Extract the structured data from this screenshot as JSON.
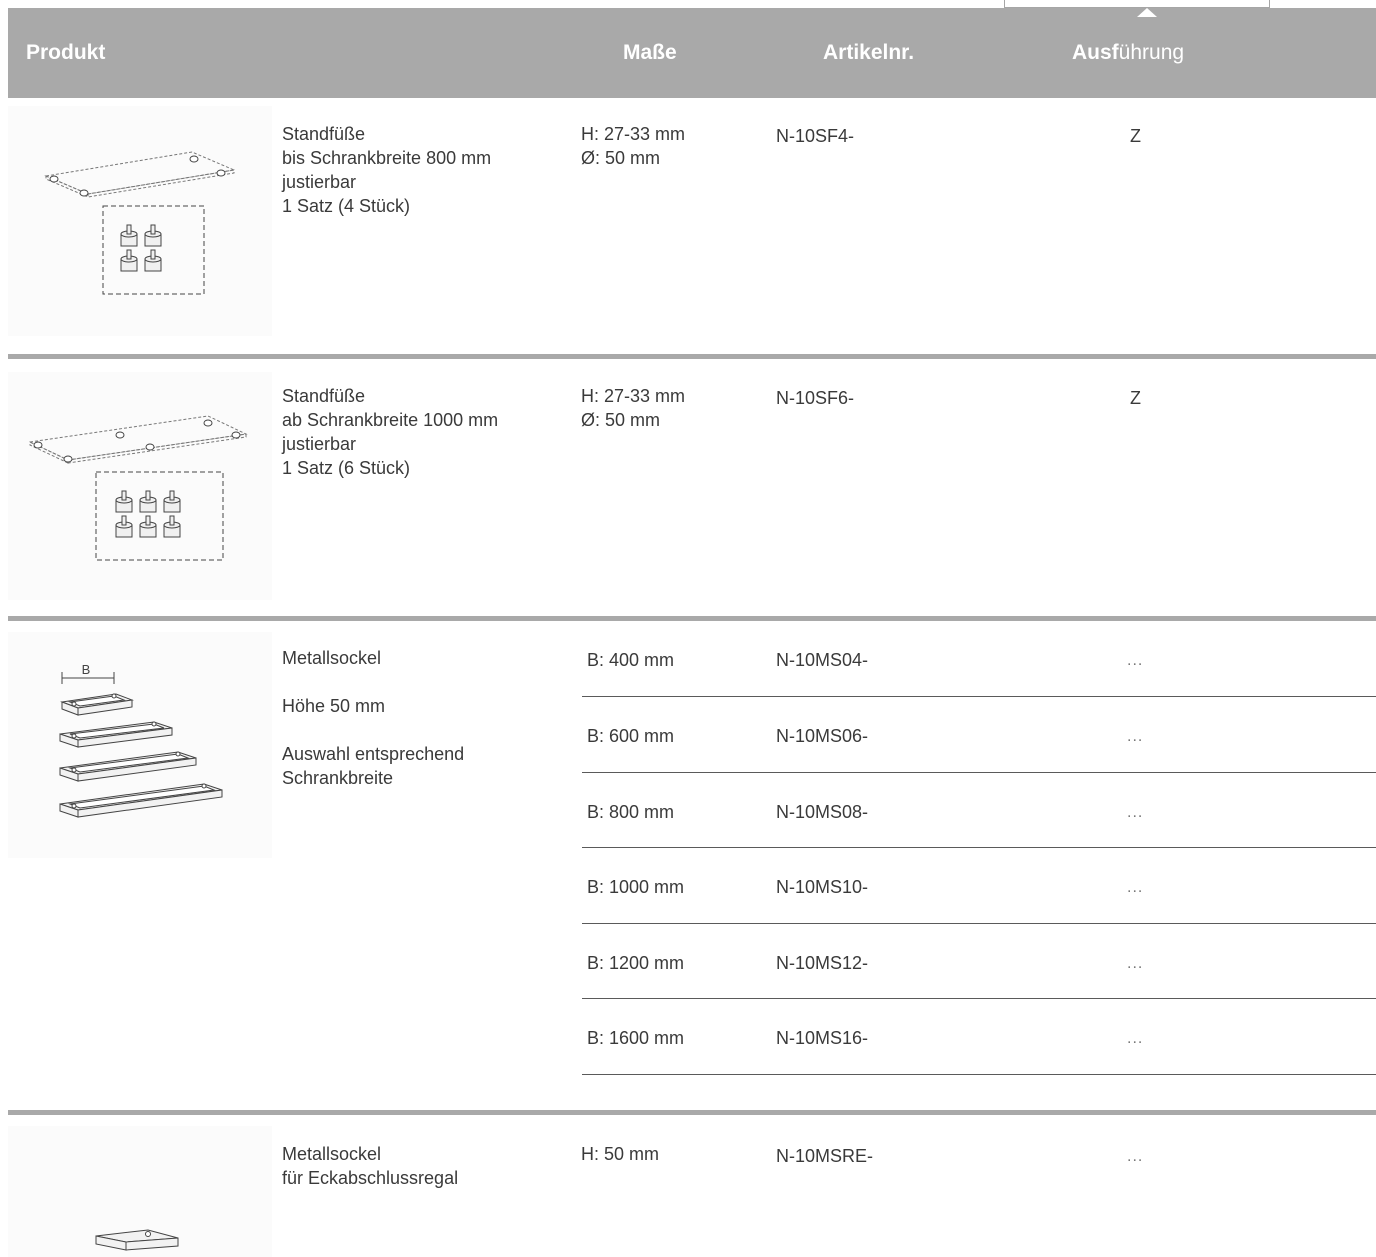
{
  "header": {
    "produkt": "Produkt",
    "masse": "Maße",
    "artikelnr": "Artikelnr.",
    "ausfuehrung_bold": "Ausf",
    "ausfuehrung_rest": "ührung"
  },
  "items": [
    {
      "lines": [
        "Standfüße",
        "bis Schrankbreite 800 mm",
        "justierbar",
        "1 Satz (4 Stück)"
      ],
      "masse": [
        "H: 27-33 mm",
        "Ø: 50 mm"
      ],
      "artikel": "N-10SF4-",
      "ausf": "Z"
    },
    {
      "lines": [
        "Standfüße",
        "ab Schrankbreite 1000 mm",
        "justierbar",
        "1 Satz (6 Stück)"
      ],
      "masse": [
        "H: 27-33 mm",
        "Ø: 50 mm"
      ],
      "artikel": "N-10SF6-",
      "ausf": "Z"
    },
    {
      "lines": [
        "Metallsockel",
        "Höhe 50 mm",
        "Auswahl entsprechend",
        "Schrankbreite"
      ],
      "sublabel": "B",
      "variants": [
        {
          "masse": "B: 400 mm",
          "artikel": "N-10MS04-",
          "ausf": "..."
        },
        {
          "masse": "B: 600 mm",
          "artikel": "N-10MS06-",
          "ausf": "..."
        },
        {
          "masse": "B: 800 mm",
          "artikel": "N-10MS08-",
          "ausf": "..."
        },
        {
          "masse": "B: 1000 mm",
          "artikel": "N-10MS10-",
          "ausf": "..."
        },
        {
          "masse": "B: 1200 mm",
          "artikel": "N-10MS12-",
          "ausf": "..."
        },
        {
          "masse": "B: 1600 mm",
          "artikel": "N-10MS16-",
          "ausf": "..."
        }
      ]
    },
    {
      "lines": [
        "Metallsockel",
        "für Eckabschlussregal"
      ],
      "masse": [
        "H: 50 mm"
      ],
      "artikel": "N-10MSRE-",
      "ausf": "..."
    }
  ]
}
